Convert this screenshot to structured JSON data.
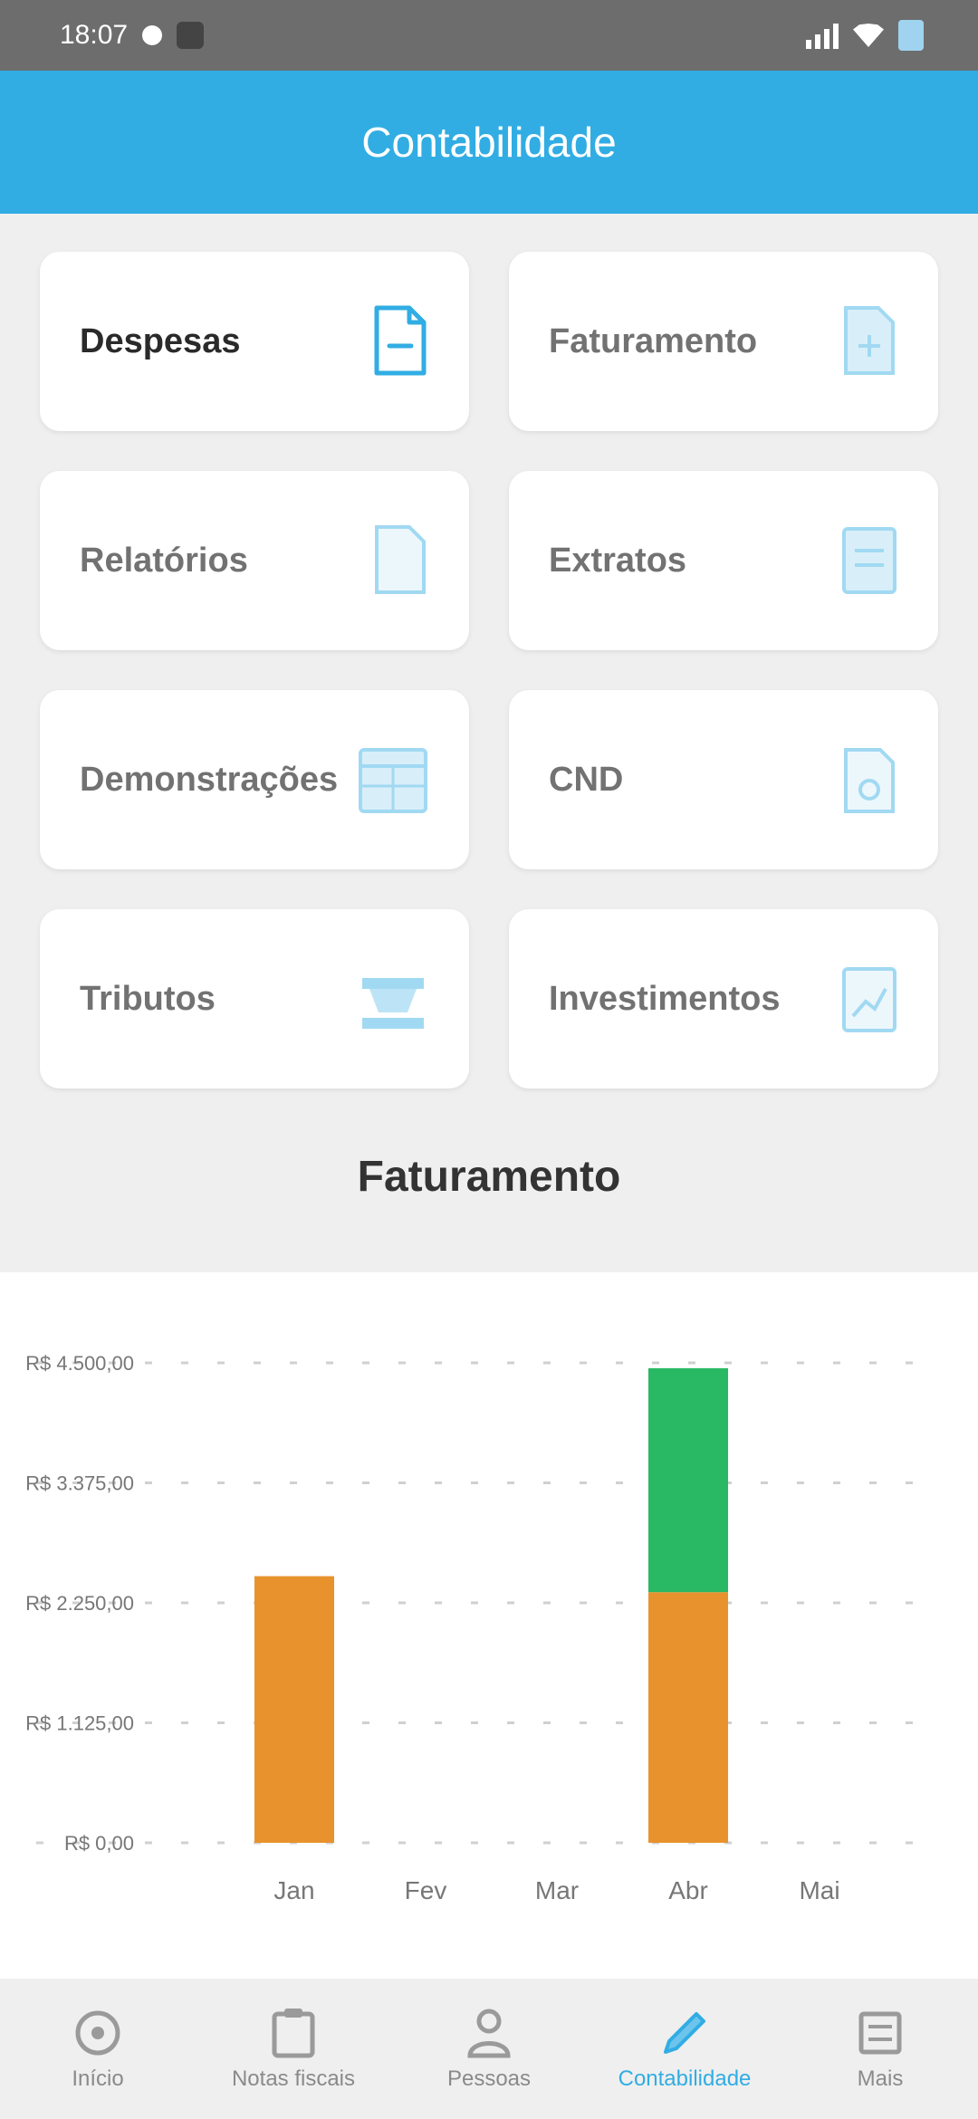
{
  "status_bar": {
    "time": "18:07",
    "icons": [
      "notification-dot-icon",
      "app-icon",
      "signal-icon",
      "wifi-icon",
      "battery-icon"
    ]
  },
  "header": {
    "title": "Contabilidade"
  },
  "cards": [
    {
      "label": "Despesas",
      "icon": "document-minus-icon"
    },
    {
      "label": "Faturamento",
      "icon": "document-plus-icon"
    },
    {
      "label": "Relatórios",
      "icon": "document-icon"
    },
    {
      "label": "Extratos",
      "icon": "statement-icon"
    },
    {
      "label": "Demonstrações",
      "icon": "calendar-table-icon"
    },
    {
      "label": "CND",
      "icon": "certificate-icon"
    },
    {
      "label": "Tributos",
      "icon": "government-building-icon"
    },
    {
      "label": "Investimentos",
      "icon": "chart-growth-icon"
    }
  ],
  "chart_section": {
    "title": "Faturamento"
  },
  "chart_data": {
    "type": "bar",
    "stacked": true,
    "categories": [
      "Jan",
      "Fev",
      "Mar",
      "Abr",
      "Mai"
    ],
    "ytick_labels": [
      "R$ 0,00",
      "R$ 1.125,00",
      "R$ 2.250,00",
      "R$ 3.375,00",
      "R$ 4.500,00"
    ],
    "ylim": [
      0,
      4500
    ],
    "grid": true,
    "series": [
      {
        "color": "#e8922e",
        "values": [
          2500,
          0,
          0,
          2350,
          0
        ]
      },
      {
        "color": "#29b864",
        "values": [
          0,
          0,
          0,
          2100,
          0
        ]
      }
    ]
  },
  "bottom_nav": [
    {
      "label": "Início",
      "icon": "home-icon",
      "active": false
    },
    {
      "label": "Notas fiscais",
      "icon": "clipboard-icon",
      "active": false
    },
    {
      "label": "Pessoas",
      "icon": "person-icon",
      "active": false
    },
    {
      "label": "Contabilidade",
      "icon": "pencil-icon",
      "active": true
    },
    {
      "label": "Mais",
      "icon": "menu-icon",
      "active": false
    }
  ],
  "colors": {
    "primary": "#31ade3",
    "bar_orange": "#e8922e",
    "bar_green": "#29b864"
  }
}
